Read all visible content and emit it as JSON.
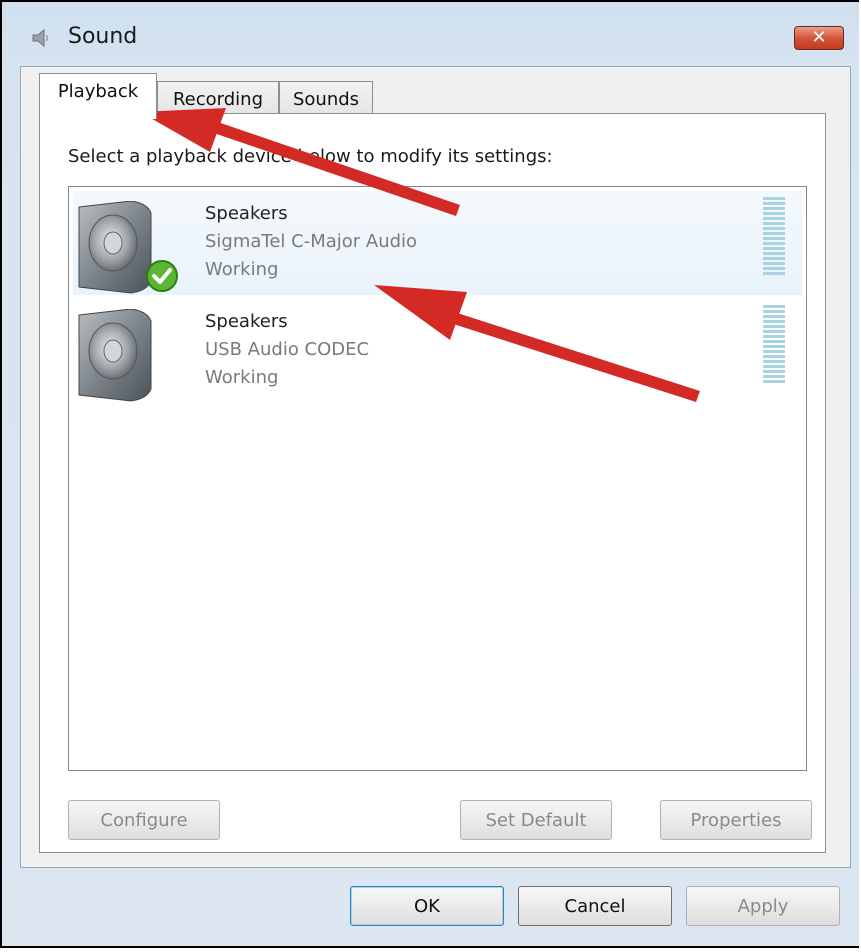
{
  "window": {
    "title": "Sound",
    "icons": {
      "title": "speaker-icon",
      "close": "close-icon"
    },
    "close_label": "✕"
  },
  "tabs": [
    {
      "label": "Playback",
      "active": true
    },
    {
      "label": "Recording",
      "active": false
    },
    {
      "label": "Sounds",
      "active": false
    }
  ],
  "instruction": "Select a playback device below to modify its settings:",
  "devices": [
    {
      "name": "Speakers",
      "driver": "SigmaTel C-Major Audio",
      "status": "Working",
      "default": true,
      "icon": "speaker-icon"
    },
    {
      "name": "Speakers",
      "driver": "USB Audio CODEC",
      "status": "Working",
      "default": false,
      "icon": "speaker-icon"
    }
  ],
  "panel_buttons": {
    "configure": "Configure",
    "set_default": "Set Default",
    "properties": "Properties"
  },
  "dialog_buttons": {
    "ok": "OK",
    "cancel": "Cancel",
    "apply": "Apply"
  },
  "colors": {
    "annotation_arrow": "#d42a26",
    "default_check": "#5cb533",
    "meter": "#a9d3e0"
  }
}
